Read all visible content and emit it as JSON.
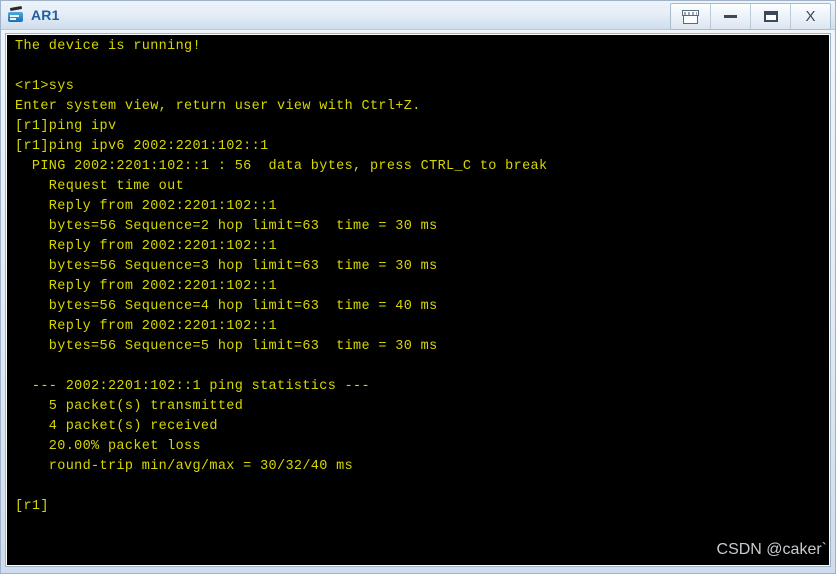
{
  "window": {
    "title": "AR1",
    "icon": "router-icon",
    "buttons": [
      {
        "name": "restore-window-button",
        "icon": "restore-icon",
        "label": ""
      },
      {
        "name": "minimize-button",
        "icon": "minimize-icon",
        "label": ""
      },
      {
        "name": "maximize-button",
        "icon": "maximize-icon",
        "label": ""
      },
      {
        "name": "close-button",
        "icon": "close-icon",
        "label": "X"
      }
    ]
  },
  "terminal": {
    "background_color": "#000000",
    "text_color": "#d7d700",
    "lines": [
      "The device is running!",
      "",
      "<r1>sys",
      "Enter system view, return user view with Ctrl+Z.",
      "[r1]ping ipv",
      "[r1]ping ipv6 2002:2201:102::1",
      "  PING 2002:2201:102::1 : 56  data bytes, press CTRL_C to break",
      "    Request time out",
      "    Reply from 2002:2201:102::1",
      "    bytes=56 Sequence=2 hop limit=63  time = 30 ms",
      "    Reply from 2002:2201:102::1",
      "    bytes=56 Sequence=3 hop limit=63  time = 30 ms",
      "    Reply from 2002:2201:102::1",
      "    bytes=56 Sequence=4 hop limit=63  time = 40 ms",
      "    Reply from 2002:2201:102::1",
      "    bytes=56 Sequence=5 hop limit=63  time = 30 ms",
      "",
      "  --- 2002:2201:102::1 ping statistics ---",
      "    5 packet(s) transmitted",
      "    4 packet(s) received",
      "    20.00% packet loss",
      "    round-trip min/avg/max = 30/32/40 ms",
      "",
      "[r1]"
    ]
  },
  "watermark": {
    "text": "CSDN @caker`"
  }
}
